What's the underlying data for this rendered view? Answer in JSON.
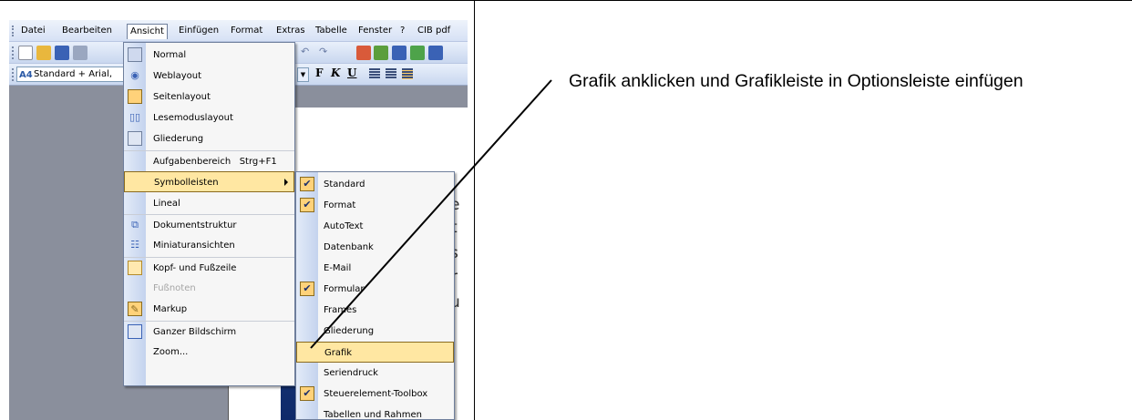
{
  "menubar": {
    "items": [
      "Datei",
      "Bearbeiten",
      "Ansicht",
      "Einfügen",
      "Format",
      "Extras",
      "Tabelle",
      "Fenster",
      "?",
      "CIB pdf"
    ]
  },
  "toolbar_format": {
    "style_value": "Standard + Arial,",
    "style_icon": "A4",
    "bold": "F",
    "italic": "K",
    "underline": "U"
  },
  "view_menu": {
    "items": [
      {
        "label": "Normal",
        "icon": "normal-view-icon"
      },
      {
        "label": "Weblayout",
        "icon": "web-layout-icon"
      },
      {
        "label": "Seitenlayout",
        "icon": "page-layout-icon"
      },
      {
        "label": "Lesemoduslayout",
        "icon": "reading-layout-icon"
      },
      {
        "label": "Gliederung",
        "icon": "outline-icon"
      },
      {
        "label": "Aufgabenbereich   Strg+F1",
        "icon": ""
      },
      {
        "label": "Symbolleisten",
        "icon": ""
      },
      {
        "label": "Lineal",
        "icon": ""
      },
      {
        "label": "Dokumentstruktur",
        "icon": "document-map-icon"
      },
      {
        "label": "Miniaturansichten",
        "icon": "thumbnails-icon"
      },
      {
        "label": "Kopf- und Fußzeile",
        "icon": "header-footer-icon"
      },
      {
        "label": "Fußnoten",
        "icon": ""
      },
      {
        "label": "Markup",
        "icon": "markup-icon"
      },
      {
        "label": "Ganzer Bildschirm",
        "icon": "full-screen-icon"
      },
      {
        "label": "Zoom...",
        "icon": ""
      }
    ]
  },
  "toolbars_submenu": {
    "items": [
      {
        "label": "Standard",
        "checked": true
      },
      {
        "label": "Format",
        "checked": true
      },
      {
        "label": "AutoText",
        "checked": false
      },
      {
        "label": "Datenbank",
        "checked": false
      },
      {
        "label": "E-Mail",
        "checked": false
      },
      {
        "label": "Formular",
        "checked": true
      },
      {
        "label": "Frames",
        "checked": false
      },
      {
        "label": "Gliederung",
        "checked": false
      },
      {
        "label": "Grafik",
        "checked": false
      },
      {
        "label": "Seriendruck",
        "checked": false
      },
      {
        "label": "Steuerelement-Toolbox",
        "checked": true
      },
      {
        "label": "Tabellen und Rahmen",
        "checked": false
      }
    ]
  },
  "doc_fragments": [
    "e",
    "t",
    "s",
    "r",
    "u"
  ],
  "annotation": {
    "text": "Grafik anklicken und Grafikleiste in Optionsleiste einfügen"
  },
  "colors": {
    "highlight": "#ffe7a2",
    "check_bg": "#ffd27a",
    "menubar": "#d6e1f5"
  }
}
